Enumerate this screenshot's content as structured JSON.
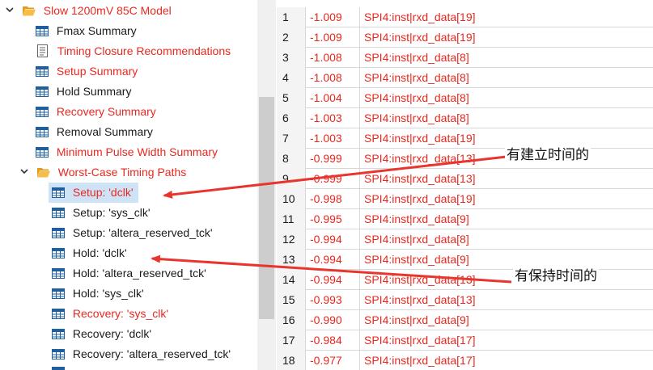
{
  "tree": {
    "root": {
      "label": "Slow 1200mV 85C Model",
      "color": "red"
    },
    "items": [
      {
        "label": "Fmax Summary",
        "icon": "table-icon",
        "color": "black"
      },
      {
        "label": "Timing Closure Recommendations",
        "icon": "document-icon",
        "color": "red"
      },
      {
        "label": "Setup Summary",
        "icon": "table-icon",
        "color": "red"
      },
      {
        "label": "Hold Summary",
        "icon": "table-icon",
        "color": "black"
      },
      {
        "label": "Recovery Summary",
        "icon": "table-icon",
        "color": "red"
      },
      {
        "label": "Removal Summary",
        "icon": "table-icon",
        "color": "black"
      },
      {
        "label": "Minimum Pulse Width Summary",
        "icon": "table-icon",
        "color": "red"
      }
    ],
    "worst_case": {
      "label": "Worst-Case Timing Paths",
      "color": "red"
    },
    "paths": [
      {
        "label": "Setup: 'dclk'",
        "color": "red",
        "selected": true
      },
      {
        "label": "Setup: 'sys_clk'",
        "color": "black"
      },
      {
        "label": "Setup: 'altera_reserved_tck'",
        "color": "black"
      },
      {
        "label": "Hold: 'dclk'",
        "color": "black"
      },
      {
        "label": "Hold: 'altera_reserved_tck'",
        "color": "black"
      },
      {
        "label": "Hold: 'sys_clk'",
        "color": "black"
      },
      {
        "label": "Recovery: 'sys_clk'",
        "color": "red"
      },
      {
        "label": "Recovery: 'dclk'",
        "color": "black"
      },
      {
        "label": "Recovery: 'altera_reserved_tck'",
        "color": "black"
      }
    ]
  },
  "table": {
    "rows": [
      {
        "n": "1",
        "slack": "-1.009",
        "node": "SPI4:inst|rxd_data[19]"
      },
      {
        "n": "2",
        "slack": "-1.009",
        "node": "SPI4:inst|rxd_data[19]"
      },
      {
        "n": "3",
        "slack": "-1.008",
        "node": "SPI4:inst|rxd_data[8]"
      },
      {
        "n": "4",
        "slack": "-1.008",
        "node": "SPI4:inst|rxd_data[8]"
      },
      {
        "n": "5",
        "slack": "-1.004",
        "node": "SPI4:inst|rxd_data[8]"
      },
      {
        "n": "6",
        "slack": "-1.003",
        "node": "SPI4:inst|rxd_data[8]"
      },
      {
        "n": "7",
        "slack": "-1.003",
        "node": "SPI4:inst|rxd_data[19]"
      },
      {
        "n": "8",
        "slack": "-0.999",
        "node": "SPI4:inst|rxd_data[13]"
      },
      {
        "n": "9",
        "slack": "-0.999",
        "node": "SPI4:inst|rxd_data[13]"
      },
      {
        "n": "10",
        "slack": "-0.998",
        "node": "SPI4:inst|rxd_data[19]"
      },
      {
        "n": "11",
        "slack": "-0.995",
        "node": "SPI4:inst|rxd_data[9]"
      },
      {
        "n": "12",
        "slack": "-0.994",
        "node": "SPI4:inst|rxd_data[8]"
      },
      {
        "n": "13",
        "slack": "-0.994",
        "node": "SPI4:inst|rxd_data[9]"
      },
      {
        "n": "14",
        "slack": "-0.994",
        "node": "SPI4:inst|rxd_data[13]"
      },
      {
        "n": "15",
        "slack": "-0.993",
        "node": "SPI4:inst|rxd_data[13]"
      },
      {
        "n": "16",
        "slack": "-0.990",
        "node": "SPI4:inst|rxd_data[9]"
      },
      {
        "n": "17",
        "slack": "-0.984",
        "node": "SPI4:inst|rxd_data[17]"
      },
      {
        "n": "18",
        "slack": "-0.977",
        "node": "SPI4:inst|rxd_data[17]"
      }
    ]
  },
  "annotations": {
    "setup_note": "有建立时间的",
    "hold_note": "有保持时间的",
    "arrow_color": "#e8352e"
  },
  "colors": {
    "red_text": "#e8281f",
    "black_text": "#1a1a1a",
    "selection": "#cfe3f7",
    "folder": "#f4b23e",
    "table_icon": "#1f5f9e"
  }
}
